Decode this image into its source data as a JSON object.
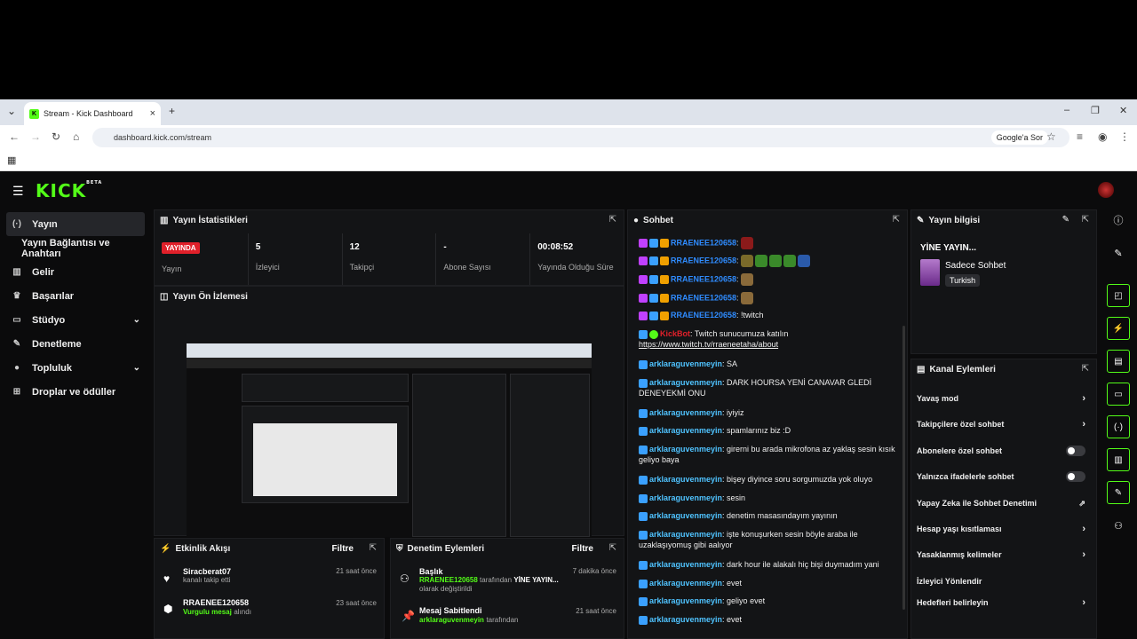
{
  "browser": {
    "tab_title": "Stream - Kick Dashboard",
    "url": "dashboard.kick.com/stream",
    "google_ask": "Google'a Sor"
  },
  "sidebar": {
    "items": [
      {
        "label": "Yayın",
        "icon": "broadcast-icon"
      },
      {
        "label": "Yayın Bağlantısı ve Anahtarı"
      },
      {
        "label": "Gelir",
        "icon": "chart-icon"
      },
      {
        "label": "Başarılar",
        "icon": "trophy-icon"
      },
      {
        "label": "Stüdyo",
        "icon": "tv-icon"
      },
      {
        "label": "Denetleme",
        "icon": "wrench-icon"
      },
      {
        "label": "Topluluk",
        "icon": "people-icon"
      },
      {
        "label": "Droplar ve ödüller",
        "icon": "gift-icon"
      }
    ]
  },
  "stats": {
    "title": "Yayın İstatistikleri",
    "live_badge": "YAYINDA",
    "live_label": "Yayın",
    "viewers": "5",
    "viewers_label": "İzleyici",
    "followers": "12",
    "followers_label": "Takipçi",
    "subs": "-",
    "subs_label": "Abone Sayısı",
    "uptime": "00:08:52",
    "uptime_label": "Yayında Olduğu Süre"
  },
  "preview": {
    "title": "Yayın Ön İzlemesi"
  },
  "activity": {
    "title": "Etkinlik Akışı",
    "filter": "Filtre",
    "events": [
      {
        "name": "Siracberat07",
        "detail": "kanalı takip etti",
        "time": "21 saat önce"
      },
      {
        "name": "RRAENEE120658",
        "detail_green": "Vurgulu mesaj",
        "detail": "alındı",
        "time": "23 saat önce"
      }
    ]
  },
  "mod_actions": {
    "title": "Denetim Eylemleri",
    "filter": "Filtre",
    "events": [
      {
        "name": "Başlık",
        "user": "RRAENEE120658",
        "mid": "tarafından",
        "value": "YİNE YAYIN...",
        "tail": "olarak değiştirildi",
        "time": "7 dakika önce"
      },
      {
        "name": "Mesaj Sabitlendi",
        "user": "arklaraguvenmeyin",
        "mid": "tarafından",
        "time": "21 saat önce"
      }
    ]
  },
  "chat": {
    "title": "Sohbet",
    "messages": [
      {
        "user": "RRAENEE120658",
        "text": ""
      },
      {
        "user": "RRAENEE120658",
        "text": ""
      },
      {
        "user": "RRAENEE120658",
        "text": ""
      },
      {
        "user": "RRAENEE120658",
        "text": ""
      },
      {
        "user": "RRAENEE120658",
        "text": ": !twitch"
      },
      {
        "user": "KickBot",
        "text": ": Twitch sunucumuza katılın",
        "link": "https://www.twitch.tv/rraeneetaha/about"
      },
      {
        "user": "arklaraguvenmeyin",
        "text": ": SA"
      },
      {
        "user": "arklaraguvenmeyin",
        "text": ": DARK HOURSA YENİ CANAVAR GLEDİ DENEYEKMİ ONU"
      },
      {
        "user": "arklaraguvenmeyin",
        "text": ": iyiyiz"
      },
      {
        "user": "arklaraguvenmeyin",
        "text": ": spamlarınız biz :D"
      },
      {
        "user": "arklaraguvenmeyin",
        "text": ": girerni bu arada mikrofona az yaklaş sesin kısık geliyo baya"
      },
      {
        "user": "arklaraguvenmeyin",
        "text": ": bişey diyince soru sorgumuzda yok oluyo"
      },
      {
        "user": "arklaraguvenmeyin",
        "text": ": sesin"
      },
      {
        "user": "arklaraguvenmeyin",
        "text": ": denetim masasındayım yayının"
      },
      {
        "user": "arklaraguvenmeyin",
        "text": ": işte konuşurken sesin böyle araba ile uzaklaşıyomuş gibi aalıyor"
      },
      {
        "user": "arklaraguvenmeyin",
        "text": ": dark hour ile alakalı hiç bişi duymadım yani"
      },
      {
        "user": "arklaraguvenmeyin",
        "text": ": evet"
      },
      {
        "user": "arklaraguvenmeyin",
        "text": ": geliyo evet"
      },
      {
        "user": "arklaraguvenmeyin",
        "text": ": evet"
      }
    ]
  },
  "stream_info": {
    "title": "Yayın bilgisi",
    "stream_title": "YİNE YAYIN...",
    "category": "Sadece Sohbet",
    "language": "Turkish"
  },
  "channel_actions": {
    "title": "Kanal Eylemleri",
    "items": [
      {
        "label": "Yavaş mod",
        "kind": "chevron"
      },
      {
        "label": "Takipçilere özel sohbet",
        "kind": "chevron"
      },
      {
        "label": "Abonelere özel sohbet",
        "kind": "toggle"
      },
      {
        "label": "Yalnızca ifadelerle sohbet",
        "kind": "toggle"
      },
      {
        "label": "Yapay Zeka ile Sohbet Denetimi",
        "kind": "external"
      },
      {
        "label": "Hesap yaşı kısıtlaması",
        "kind": "chevron"
      },
      {
        "label": "Yasaklanmış kelimeler",
        "kind": "chevron"
      },
      {
        "label": "İzleyici Yönlendir",
        "kind": "none"
      },
      {
        "label": "Hedefleri belirleyin",
        "kind": "chevron"
      }
    ]
  }
}
